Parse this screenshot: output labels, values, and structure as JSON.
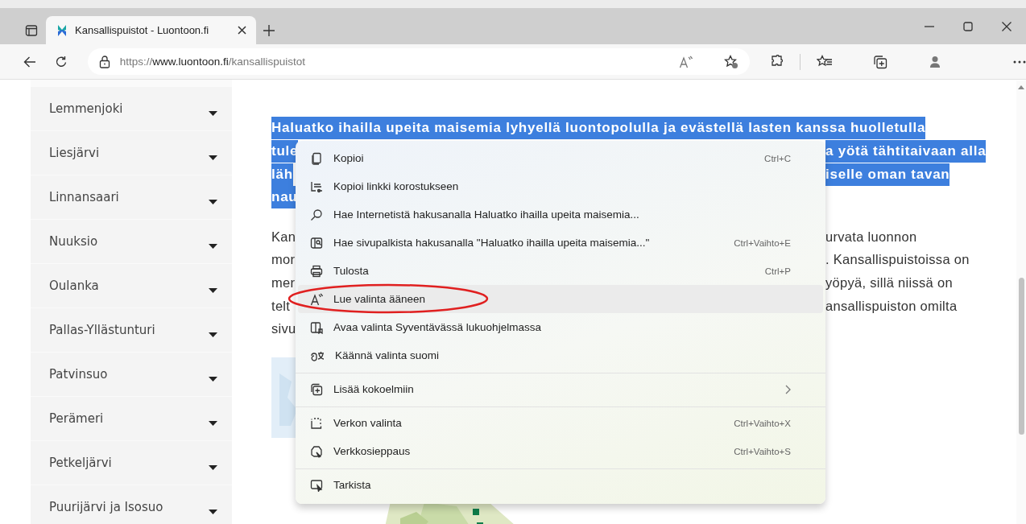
{
  "tab": {
    "title": "Kansallispuistot - Luontoon.fi",
    "selected": true
  },
  "address": {
    "scheme": "https://",
    "host": "www.luontoon.fi",
    "path": "/kansallispuistot"
  },
  "sidebar": {
    "items": [
      {
        "label": "Lemmenjoki"
      },
      {
        "label": "Liesjärvi"
      },
      {
        "label": "Linnansaari"
      },
      {
        "label": "Nuuksio"
      },
      {
        "label": "Oulanka"
      },
      {
        "label": "Pallas-Yllästunturi"
      },
      {
        "label": "Patvinsuo"
      },
      {
        "label": "Perämeri"
      },
      {
        "label": "Petkeljärvi"
      },
      {
        "label": "Puurijärvi ja Isosuo"
      }
    ]
  },
  "article": {
    "selected_lines": [
      {
        "left": "Haluatko ihailla upeita maisemia lyhyellä luontopolulla ja evästellä lasten kanssa huolletulla"
      },
      {
        "left": "tule",
        "right": "a yötä tähtitaivaan alla"
      },
      {
        "left": "läh",
        "right": "iselle oman tavan"
      },
      {
        "left": "nau"
      }
    ],
    "body_lines": [
      {
        "left": "Kan",
        "right": "urvata luonnon"
      },
      {
        "left": "mor",
        "right": ". Kansallispuistoissa on"
      },
      {
        "left": "mer",
        "right": "yöpyä, sillä niissä on"
      },
      {
        "left": "telt",
        "right": "ansallispuiston omilta"
      },
      {
        "left": "sivu"
      }
    ]
  },
  "context_menu": {
    "groups": [
      [
        {
          "label": "Kopioi",
          "shortcut": "Ctrl+C",
          "hovered": false,
          "circled": false,
          "has_submenu": false
        },
        {
          "label": "Kopioi linkki korostukseen",
          "hovered": false,
          "circled": false,
          "has_submenu": false
        },
        {
          "label": "Hae Internetistä hakusanalla Haluatko ihailla upeita maisemia...",
          "hovered": false,
          "circled": false,
          "has_submenu": false
        },
        {
          "label": "Hae sivupalkista hakusanalla \"Haluatko ihailla upeita maisemia...\"",
          "shortcut": "Ctrl+Vaihto+E",
          "hovered": false,
          "circled": false,
          "has_submenu": false
        },
        {
          "label": "Tulosta",
          "shortcut": "Ctrl+P",
          "hovered": false,
          "circled": false,
          "has_submenu": false
        },
        {
          "label": "Lue valinta ääneen",
          "hovered": true,
          "circled": true,
          "has_submenu": false
        },
        {
          "label": "Avaa valinta Syventävässä lukuohjelmassa",
          "hovered": false,
          "circled": false,
          "has_submenu": false
        },
        {
          "label": "Käännä valinta suomi",
          "hovered": false,
          "circled": false,
          "has_submenu": false
        }
      ],
      [
        {
          "label": "Lisää kokoelmiin",
          "hovered": false,
          "circled": false,
          "has_submenu": true
        }
      ],
      [
        {
          "label": "Verkon valinta",
          "shortcut": "Ctrl+Vaihto+X",
          "hovered": false,
          "circled": false,
          "has_submenu": false
        },
        {
          "label": "Verkkosieppaus",
          "shortcut": "Ctrl+Vaihto+S",
          "hovered": false,
          "circled": false,
          "has_submenu": false
        }
      ],
      [
        {
          "label": "Tarkista",
          "hovered": false,
          "circled": false,
          "has_submenu": false
        }
      ]
    ]
  }
}
